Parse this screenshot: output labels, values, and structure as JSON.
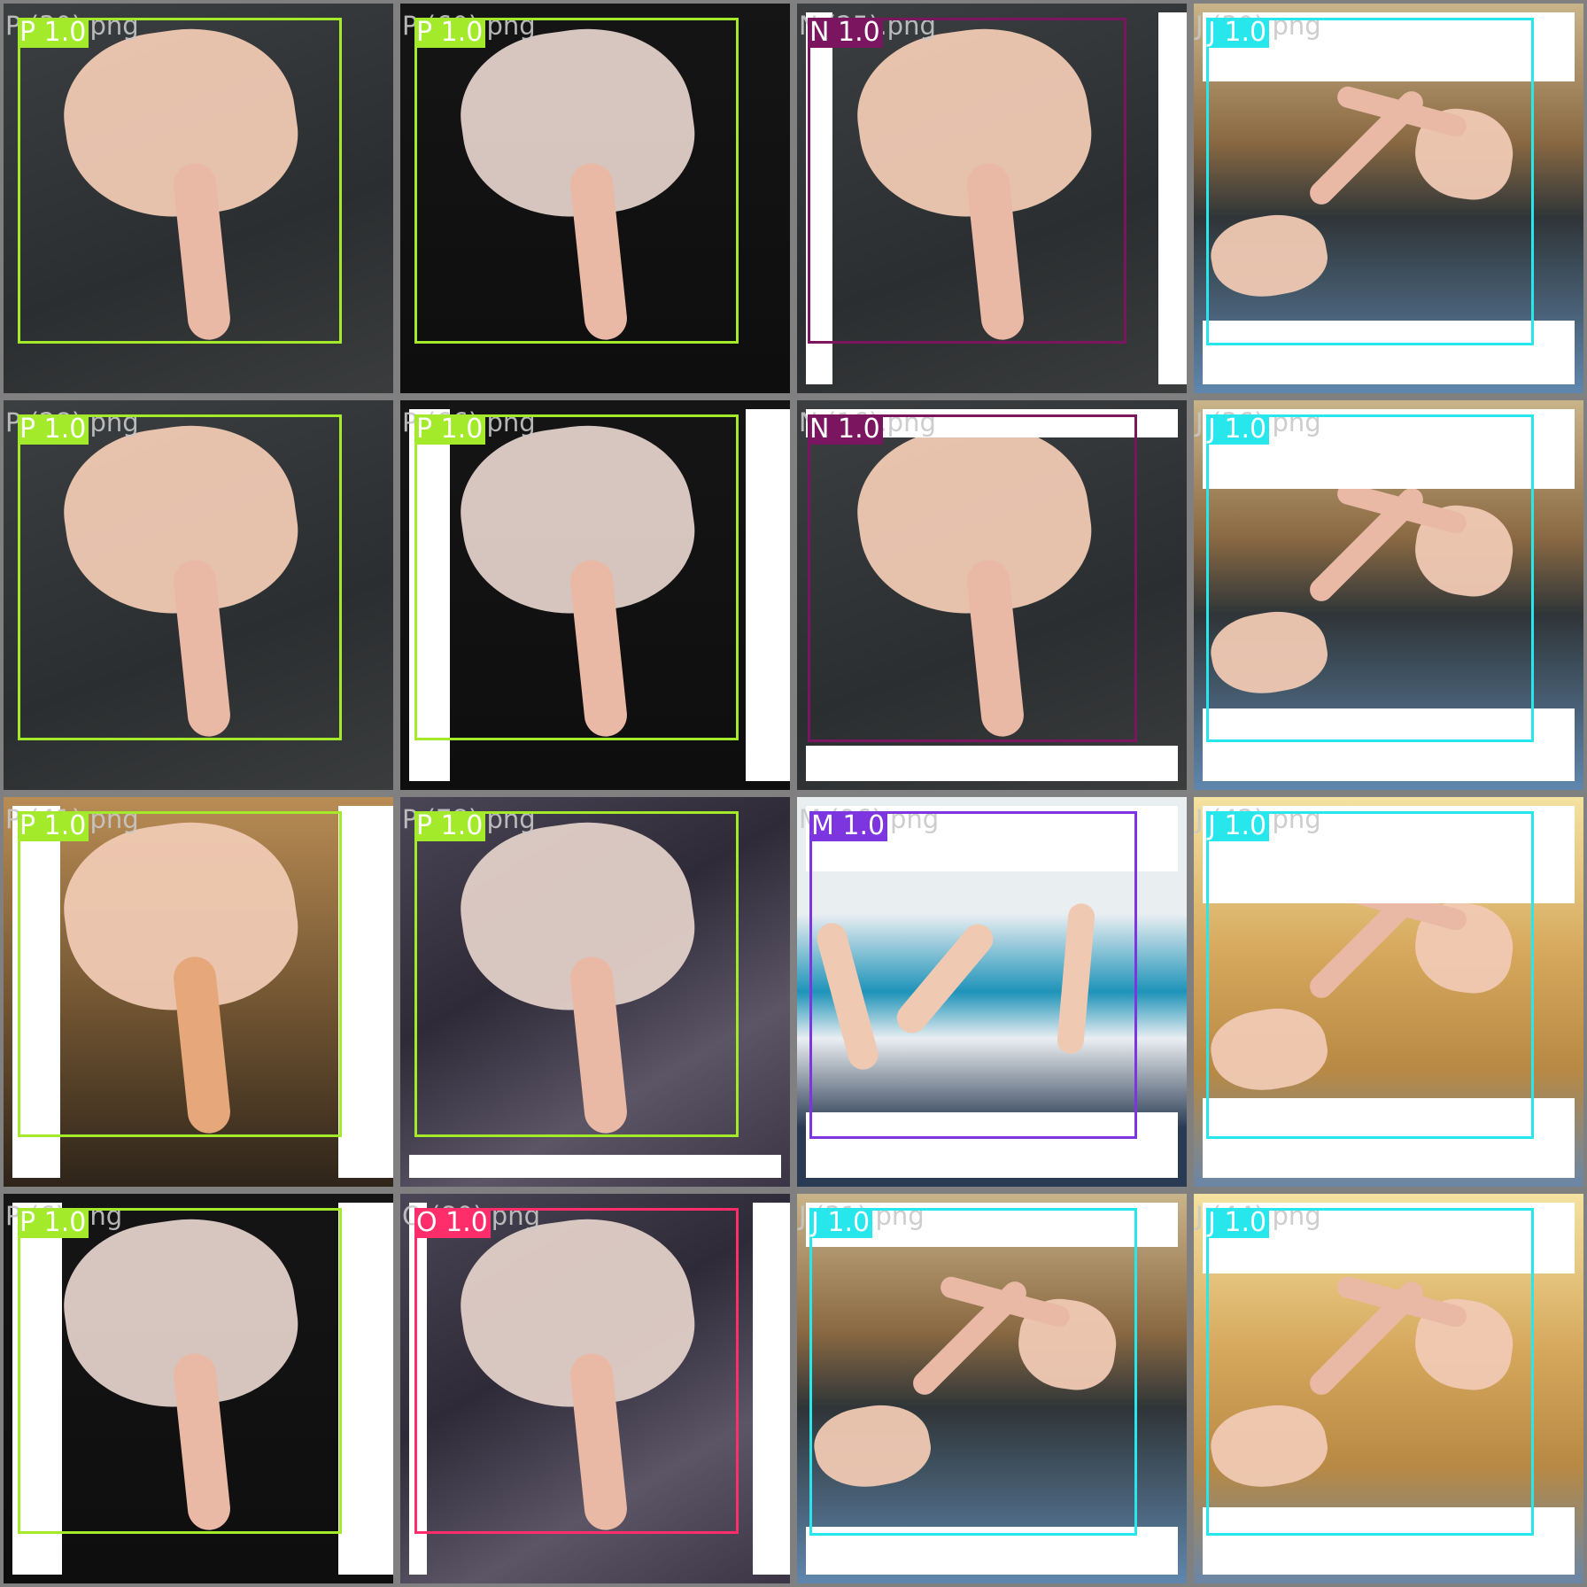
{
  "class_colors": {
    "P": "#a3ea2a",
    "N": "#7b1560",
    "J": "#27e6ec",
    "M": "#7d35e0",
    "O": "#ff2d6a"
  },
  "tiles": [
    {
      "file": "P (30).png",
      "label": "P 1.0",
      "cls": "P",
      "bg": "dark-shirt"
    },
    {
      "file": "P (60).png",
      "label": "P 1.0",
      "cls": "P",
      "bg": "black"
    },
    {
      "file": "N (25).png",
      "label": "N 1.0",
      "cls": "N",
      "bg": "dark-shirt"
    },
    {
      "file": "J (30).png",
      "label": "J 1.0",
      "cls": "J",
      "bg": "person"
    },
    {
      "file": "P (28).png",
      "label": "P 1.0",
      "cls": "P",
      "bg": "dark-shirt"
    },
    {
      "file": "P (66).png",
      "label": "P 1.0",
      "cls": "P",
      "bg": "black"
    },
    {
      "file": "N (16).png",
      "label": "N 1.0",
      "cls": "N",
      "bg": "dark-shirt"
    },
    {
      "file": "J (36).png",
      "label": "J 1.0",
      "cls": "J",
      "bg": "person"
    },
    {
      "file": "P (41).png",
      "label": "P 1.0",
      "cls": "P",
      "bg": "warm"
    },
    {
      "file": "P (78).png",
      "label": "P 1.0",
      "cls": "P",
      "bg": "marble"
    },
    {
      "file": "M (96).png",
      "label": "M 1.0",
      "cls": "M",
      "bg": "tshirt"
    },
    {
      "file": "J (42).png",
      "label": "J 1.0",
      "cls": "J",
      "bg": "person-yellow"
    },
    {
      "file": "P (6).png",
      "label": "P 1.0",
      "cls": "P",
      "bg": "black"
    },
    {
      "file": "O (80).png",
      "label": "O 1.0",
      "cls": "O",
      "bg": "marble"
    },
    {
      "file": "J (31).png",
      "label": "J 1.0",
      "cls": "J",
      "bg": "person"
    },
    {
      "file": "J (44).png",
      "label": "J 1.0",
      "cls": "J",
      "bg": "person-yellow"
    }
  ]
}
